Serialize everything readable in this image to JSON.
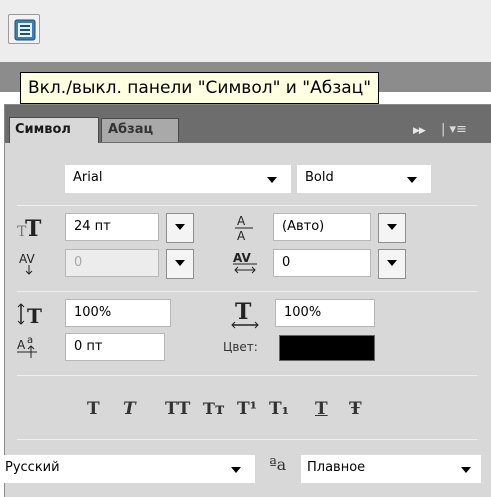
{
  "toolbar": {
    "toggle_icon": "character-paragraph-panel-icon"
  },
  "tooltip": {
    "text": "Вкл./выкл. панели \"Символ\" и \"Абзац\""
  },
  "panel": {
    "tabs": [
      {
        "label": "Символ",
        "active": true
      },
      {
        "label": "Абзац",
        "active": false
      }
    ],
    "font_family": "Arial",
    "font_style": "Bold",
    "font_size": "24 пт",
    "leading": "(Авто)",
    "kerning": "0",
    "tracking": "0",
    "vertical_scale": "100%",
    "horizontal_scale": "100%",
    "baseline_shift": "0 пт",
    "color_label": "Цвет:",
    "color_value": "#000000",
    "style_buttons": [
      "Т",
      "Т",
      "ТТ",
      "Тт",
      "Т¹",
      "Т₁",
      "Т",
      "Ŧ"
    ],
    "language": "Русский",
    "antialias_icon_text": "ªa",
    "antialias": "Плавное"
  }
}
